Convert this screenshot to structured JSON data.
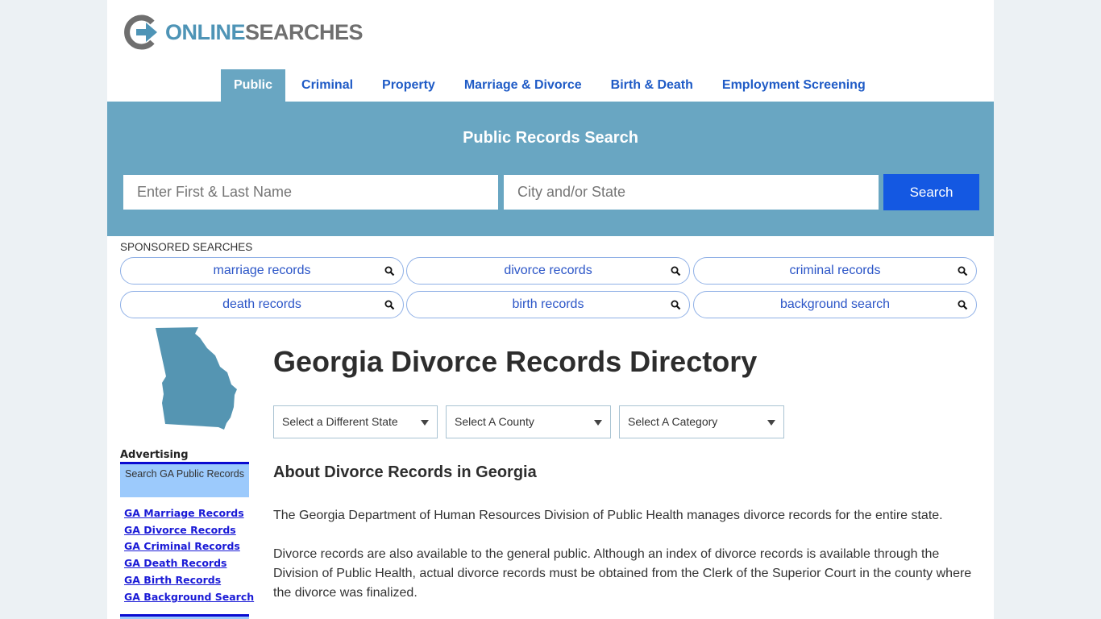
{
  "brand": {
    "logo_part1": "ONLINE",
    "logo_part2": "SEARCHES",
    "colors": {
      "primary": "#4e94b6",
      "secondary": "#6f6f6f"
    }
  },
  "nav": {
    "items": [
      {
        "label": "Public",
        "active": true
      },
      {
        "label": "Criminal",
        "active": false
      },
      {
        "label": "Property",
        "active": false
      },
      {
        "label": "Marriage & Divorce",
        "active": false
      },
      {
        "label": "Birth & Death",
        "active": false
      },
      {
        "label": "Employment Screening",
        "active": false
      }
    ]
  },
  "search": {
    "title": "Public Records Search",
    "name_placeholder": "Enter First & Last Name",
    "location_placeholder": "City and/or State",
    "button_label": "Search",
    "colors": {
      "banner": "#69a6c2",
      "button": "#1458e2"
    }
  },
  "sponsored": {
    "label": "SPONSORED SEARCHES",
    "items": [
      "marriage records",
      "divorce records",
      "criminal records",
      "death records",
      "birth records",
      "background search"
    ]
  },
  "sidebar": {
    "map_icon": "georgia-state-map",
    "advertising_label": "Advertising",
    "ad_box_text": "Search GA Public Records",
    "links": [
      "GA Marriage Records",
      "GA Divorce Records",
      "GA Criminal Records",
      "GA Death Records",
      "GA Birth Records",
      "GA Background Search"
    ]
  },
  "main": {
    "title": "Georgia Divorce Records Directory",
    "selects": {
      "state": "Select a Different State",
      "county": "Select A County",
      "category": "Select A Category"
    },
    "section_title": "About Divorce Records in Georgia",
    "paragraphs": [
      "The Georgia Department of Human Resources Division of Public Health manages divorce records for the entire state.",
      "Divorce records are also available to the general public. Although an index of divorce records is available through the Division of Public Health, actual divorce records must be obtained from the Clerk of the Superior Court in the county where the divorce was finalized."
    ]
  }
}
